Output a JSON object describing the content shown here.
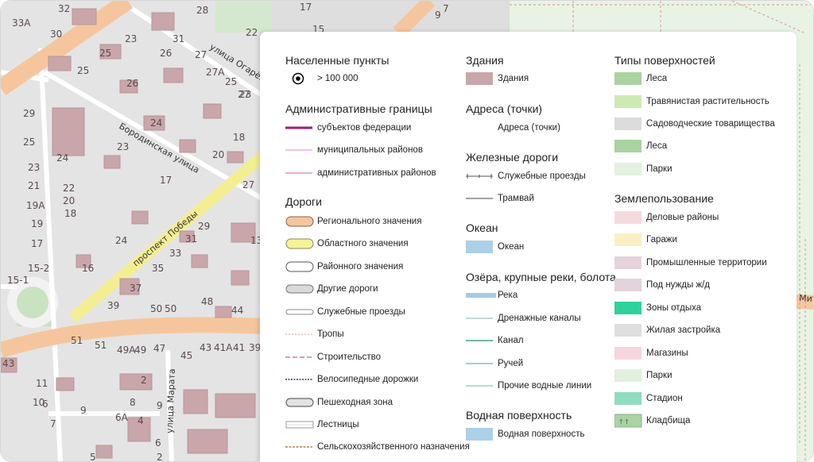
{
  "map": {
    "house_numbers": [
      "32",
      "33А",
      "30",
      "28",
      "17",
      "9",
      "7",
      "25",
      "23",
      "31",
      "26",
      "22",
      "15",
      "27",
      "25",
      "27А",
      "25",
      "27",
      "26",
      "23",
      "29",
      "24",
      "18",
      "25",
      "23",
      "24",
      "20",
      "23",
      "21",
      "22",
      "20",
      "18",
      "17",
      "27",
      "19А",
      "19",
      "29",
      "24",
      "31",
      "13",
      "17",
      "33",
      "15-2",
      "15-1",
      "16",
      "35",
      "37",
      "39",
      "50",
      "50",
      "48",
      "44",
      "51",
      "51",
      "49А",
      "49",
      "47",
      "43",
      "41А",
      "41",
      "39",
      "43",
      "45",
      "11",
      "2",
      "10",
      "9",
      "6",
      "8",
      "7",
      "6А",
      "4",
      "9",
      "6",
      "5",
      "2"
    ],
    "streets": [
      "улица Огарёва",
      "Бородинская улица",
      "проспект Победы",
      "улица Марата",
      "Митр"
    ]
  },
  "legend": {
    "settlements": {
      "title": "Населенные пункты",
      "items": [
        "> 100 000"
      ]
    },
    "admin": {
      "title": "Административные границы",
      "items": [
        "субъектов федерации",
        "муниципальных районов",
        "административных районов"
      ]
    },
    "roads": {
      "title": "Дороги",
      "items": [
        "Регионального значения",
        "Областного значения",
        "Районного значения",
        "Другие дороги",
        "Служебные проезды",
        "Тропы",
        "Строительство",
        "Велосипедные дорожки",
        "Пешеходная зона",
        "Лестницы",
        "Сельскохозяйственного назначения"
      ]
    },
    "buildings": {
      "title": "Здания",
      "items": [
        "Здания"
      ]
    },
    "addresses": {
      "title": "Адреса (точки)",
      "items": [
        "Адреса (точки)"
      ]
    },
    "railways": {
      "title": "Железные дороги",
      "items": [
        "Служебные проезды",
        "Трамвай"
      ]
    },
    "ocean": {
      "title": "Океан",
      "items": [
        "Океан"
      ]
    },
    "lakes": {
      "title": "Озёра, крупные реки, болота",
      "items": [
        "Река",
        "Дренажные каналы",
        "Канал",
        "Ручей",
        "Прочие водные линии"
      ]
    },
    "water": {
      "title": "Водная поверхность",
      "items": [
        "Водная поверхность"
      ]
    },
    "surfaces": {
      "title": "Типы поверхностей",
      "items": [
        "Леса",
        "Травянистая растительность",
        "Садоводческие товарищества",
        "Леса",
        "Парки"
      ]
    },
    "landuse": {
      "title": "Землепользование",
      "items": [
        "Деловые районы",
        "Гаражи",
        "Промышленные территории",
        "Под нужды ж/д",
        "Зоны отдыха",
        "Жилая застройка",
        "Магазины",
        "Парки",
        "Стадион",
        "Кладбища"
      ]
    }
  },
  "colors": {
    "road_regional": "#f5c69d",
    "road_regional_border": "#9a6b44",
    "road_oblast": "#f6f29a",
    "building": "#c9a6aa",
    "land": "#e6e6e6",
    "forest": "#a9d3a0",
    "park": "#e3f1df",
    "water": "#acd0e6",
    "federal_border": "#9b1d7a"
  }
}
